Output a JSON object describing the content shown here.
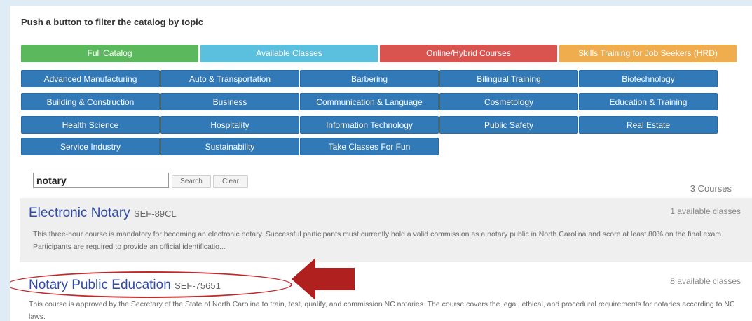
{
  "heading": "Push a button to filter the catalog by topic",
  "filters": [
    {
      "label": "Full Catalog",
      "color": "#5cb85c"
    },
    {
      "label": "Available Classes",
      "color": "#5bc0de"
    },
    {
      "label": "Online/Hybrid Courses",
      "color": "#d9534f"
    },
    {
      "label": "Skills Training for Job Seekers (HRD)",
      "color": "#f0ad4e"
    }
  ],
  "topics": [
    "Advanced Manufacturing",
    "Auto & Transportation",
    "Barbering",
    "Bilingual Training",
    "Biotechnology",
    "Building & Construction",
    "Business",
    "Communication & Language",
    "Cosmetology",
    "Education & Training",
    "Health Science",
    "Hospitality",
    "Information Technology",
    "Public Safety",
    "Real Estate",
    "Service Industry",
    "Sustainability",
    "Take Classes For Fun"
  ],
  "search": {
    "value": "notary",
    "search_label": "Search",
    "clear_label": "Clear",
    "count": "3 Courses"
  },
  "results": [
    {
      "title": "Electronic Notary",
      "code": "SEF-89CL",
      "available": "1 available classes",
      "description": "This three-hour course is mandatory for becoming an electronic notary. Successful participants must currently hold a valid commission as a notary public in North Carolina and score at least 80% on the final exam. Participants are required to provide an official identificatio..."
    },
    {
      "title": "Notary Public Education",
      "code": "SEF-75651",
      "available": "8 available classes",
      "description": "This course is approved by the Secretary of the State of North Carolina to train, test, qualify, and commission NC notaries. The course covers the legal, ethical, and procedural requirements for notaries according to NC laws."
    }
  ],
  "annotation_color": "#c0282a"
}
